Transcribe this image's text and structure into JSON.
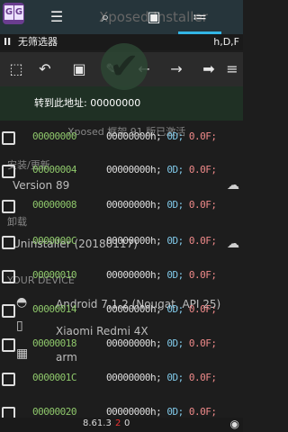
{
  "header": {
    "logo_text": "GG",
    "background_title": "Xposed Installer",
    "tabs": [
      {
        "icon": "sliders-icon"
      },
      {
        "icon": "search-icon"
      },
      {
        "icon": "save-icon"
      },
      {
        "icon": "list-icon"
      }
    ]
  },
  "filter": {
    "pause_symbol": "II",
    "label": "无筛选器",
    "types": "h,D,F"
  },
  "toolbar": {
    "icons": [
      "select-icon",
      "undo-icon",
      "save-icon",
      "edit-icon",
      "arrow-left-icon",
      "arrow-right-icon",
      "arrow-forward-icon",
      "menu-icon"
    ]
  },
  "goto": {
    "text": "转到此地址: 00000000"
  },
  "rows": [
    {
      "address": "00000000",
      "value": "00000000h;",
      "dec": "0D;",
      "flt": "0.0F;"
    },
    {
      "address": "00000004",
      "value": "00000000h;",
      "dec": "0D;",
      "flt": "0.0F;"
    },
    {
      "address": "00000008",
      "value": "00000000h;",
      "dec": "0D;",
      "flt": "0.0F;"
    },
    {
      "address": "0000000C",
      "value": "00000000h;",
      "dec": "0D;",
      "flt": "0.0F;"
    },
    {
      "address": "00000010",
      "value": "00000000h;",
      "dec": "0D;",
      "flt": "0.0F;"
    },
    {
      "address": "00000014",
      "value": "00000000h;",
      "dec": "0D;",
      "flt": "0.0F;"
    },
    {
      "address": "00000018",
      "value": "00000000h;",
      "dec": "0D;",
      "flt": "0.0F;"
    },
    {
      "address": "0000001C",
      "value": "00000000h;",
      "dec": "0D;",
      "flt": "0.0F;"
    },
    {
      "address": "00000020",
      "value": "00000000h;",
      "dec": "0D;",
      "flt": "0.0F;"
    }
  ],
  "background": {
    "framework_line": "Xposed 框架 91 版已激活",
    "install_update": "安装/更新",
    "version": "Version 89",
    "uninstall": "卸载",
    "uninstaller": "Uninstaller (20180117)",
    "your_device": "YOUR DEVICE",
    "android": "Android 7.1.2 (Nougat, API 25)",
    "device": "Xiaomi Redmi 4X",
    "arch": "arm"
  },
  "status": {
    "version": "8.61.3",
    "error_count": "2",
    "count": "0"
  },
  "colors": {
    "address": "#8ec76b",
    "decimal": "#80c8e8",
    "float": "#f08a8a",
    "accent": "#33b5e5"
  }
}
